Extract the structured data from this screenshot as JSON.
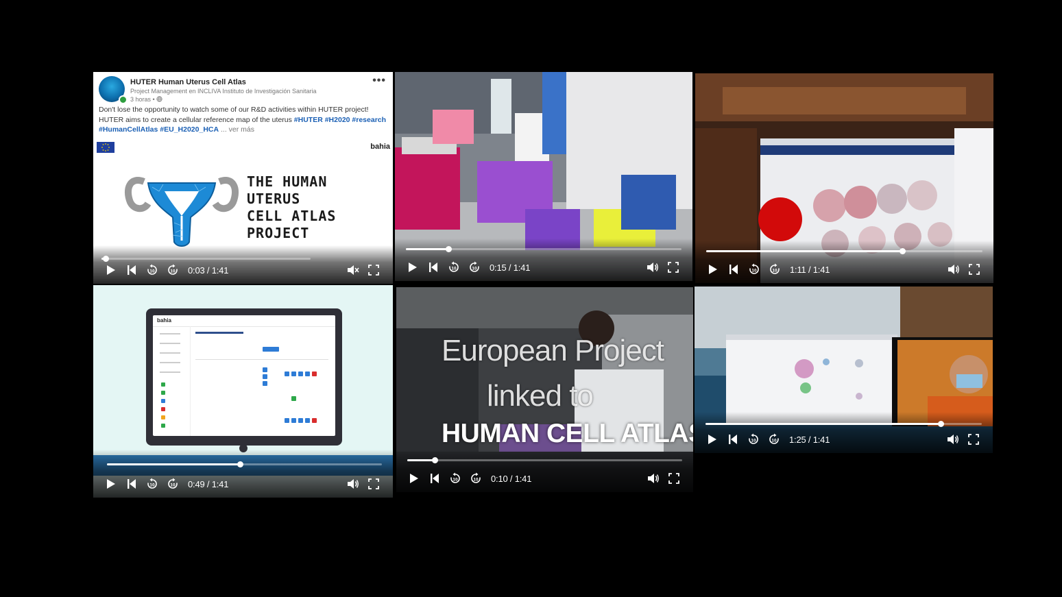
{
  "post": {
    "page_name": "HUTER Human Uterus Cell Atlas",
    "subtitle": "Project Management en INCLIVA Instituto de Investigación Sanitaria",
    "time": "3 horas •",
    "more": "•••",
    "text": "Don't lose the opportunity to watch some of our R&D activities within HUTER project! HUTER aims to create a cellular reference map of the uterus",
    "hashtags": "#HUTER #H2020 #research #HumanCellAtlas #EU_H2020_HCA",
    "see_more": "... ver más",
    "brand": "bahia",
    "poster_lines": [
      "THE HUMAN",
      "UTERUS",
      "CELL ATLAS",
      "PROJECT"
    ]
  },
  "overlay": {
    "line1": "European Project",
    "line2": "linked to",
    "line3": "HUMAN CELL ATLAS"
  },
  "app": {
    "logo": "bahia"
  },
  "videos": [
    {
      "id": "v1",
      "time": "0:03 / 1:41",
      "progress": 0.02
    },
    {
      "id": "v2",
      "time": "0:15 / 1:41",
      "progress": 0.155
    },
    {
      "id": "v3",
      "time": "1:11 / 1:41",
      "progress": 0.71
    },
    {
      "id": "v4",
      "time": "0:49 / 1:41",
      "progress": 0.485
    },
    {
      "id": "v5",
      "time": "0:10 / 1:41",
      "progress": 0.1
    },
    {
      "id": "v6",
      "time": "1:25 / 1:41",
      "progress": 0.85
    }
  ],
  "colors": {
    "background": "#000000",
    "hashtag": "#1a5fb4",
    "uterus": "#1d8ad6",
    "control_icon": "#ffffff"
  }
}
